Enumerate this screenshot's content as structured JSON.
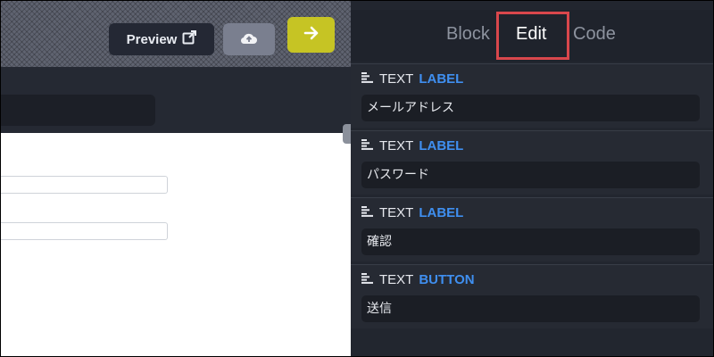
{
  "toolbar": {
    "preview_label": "Preview",
    "preview_icon": "external-link-icon",
    "upload_icon": "cloud-upload-icon",
    "next_icon": "arrow-right-icon"
  },
  "panel": {
    "tabs": [
      {
        "label": "Block",
        "active": false
      },
      {
        "label": "Edit",
        "active": true
      },
      {
        "label": "Code",
        "active": false
      }
    ],
    "sections": [
      {
        "type": "TEXT",
        "kind": "LABEL",
        "value": "メールアドレス"
      },
      {
        "type": "TEXT",
        "kind": "LABEL",
        "value": "パスワード"
      },
      {
        "type": "TEXT",
        "kind": "LABEL",
        "value": "確認"
      },
      {
        "type": "TEXT",
        "kind": "BUTTON",
        "value": "送信"
      }
    ]
  },
  "colors": {
    "accent_blue": "#3f8ff0",
    "next_button": "#c6c424",
    "highlight": "#d9474c"
  }
}
